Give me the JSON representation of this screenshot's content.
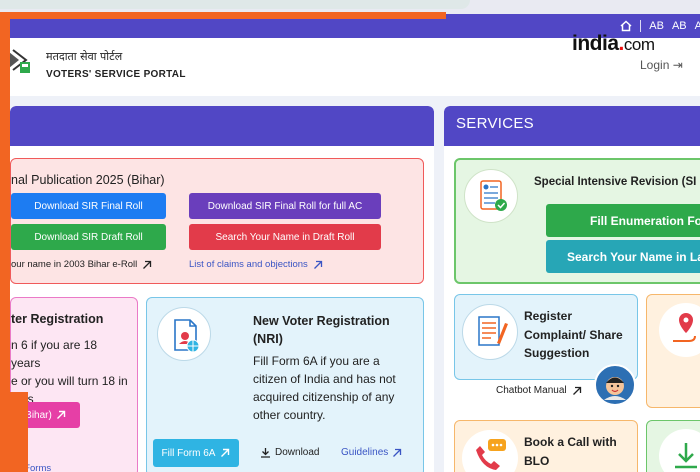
{
  "topbar": {
    "lang_options": [
      "AB",
      "AB",
      "A"
    ]
  },
  "header": {
    "hindi_title": "मतदाता सेवा पोर्टल",
    "english_title": "VOTERS' SERVICE PORTAL",
    "login_label": "Login",
    "watermark": {
      "brand": "india",
      "dot": ".",
      "suffix": "com"
    }
  },
  "final_publication": {
    "title": "nal Publication 2025 (Bihar)",
    "buttons": {
      "download_final": "Download SIR Final Roll",
      "download_final_full": "Download SIR Final Roll for full AC",
      "download_draft": "Download SIR Draft Roll",
      "search_draft": "Search Your Name in Draft Roll"
    },
    "links": {
      "search_2003": "our name in 2003 Bihar e-Roll",
      "claims": "List of claims and objections"
    }
  },
  "voter_registration": {
    "title": "ter Registration",
    "lines": [
      "n 6 if you are 18 years",
      "e or you will turn 18 in",
      "nths"
    ],
    "button": "Bihar)",
    "forms_link": "aft Forms"
  },
  "nri": {
    "title": "New Voter Registration (NRI)",
    "text": "Fill Form 6A if you are a citizen of India and has not acquired citizenship of any other country.",
    "fill_button": "Fill Form 6A",
    "download": "Download",
    "guidelines": "Guidelines"
  },
  "services": {
    "title": "SERVICES",
    "sir": {
      "title": "Special Intensive Revision (SI",
      "fill_button": "Fill Enumeration For",
      "search_button": "Search Your Name in La"
    },
    "complaint": {
      "title": "Register Complaint/ Share Suggestion",
      "chatbot": "Chatbot Manual"
    },
    "call": {
      "title": "Book a Call with BLO"
    }
  },
  "colors": {
    "primary_purple": "#5147c5",
    "accent_orange": "#f26522",
    "green": "#2ea94b",
    "blue": "#1d7cf2",
    "red": "#e23b4a",
    "pink": "#e63fa6",
    "cyan": "#2fb4e3"
  }
}
